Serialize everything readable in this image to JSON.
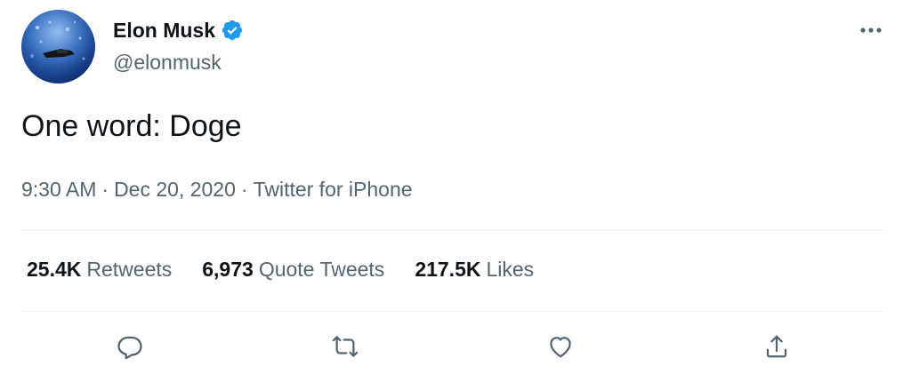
{
  "tweet": {
    "author": {
      "display_name": "Elon Musk",
      "handle": "@elonmusk",
      "verified": true,
      "avatar_icon": "avatar-image"
    },
    "text": "One word: Doge",
    "time": "9:30 AM",
    "date": "Dec 20, 2020",
    "separator": "·",
    "source": "Twitter for iPhone",
    "more_icon": "more-horizontal-icon"
  },
  "stats": [
    {
      "count": "25.4K",
      "label": "Retweets"
    },
    {
      "count": "6,973",
      "label": "Quote Tweets"
    },
    {
      "count": "217.5K",
      "label": "Likes"
    }
  ],
  "actions": [
    {
      "name": "reply",
      "icon": "reply-icon"
    },
    {
      "name": "retweet",
      "icon": "retweet-icon"
    },
    {
      "name": "like",
      "icon": "like-icon"
    },
    {
      "name": "share",
      "icon": "share-icon"
    }
  ],
  "colors": {
    "primary_text": "#0f1419",
    "secondary_text": "#536471",
    "verified_blue": "#1d9bf0",
    "divider": "#eff3f4",
    "icon_gray": "#536471"
  }
}
